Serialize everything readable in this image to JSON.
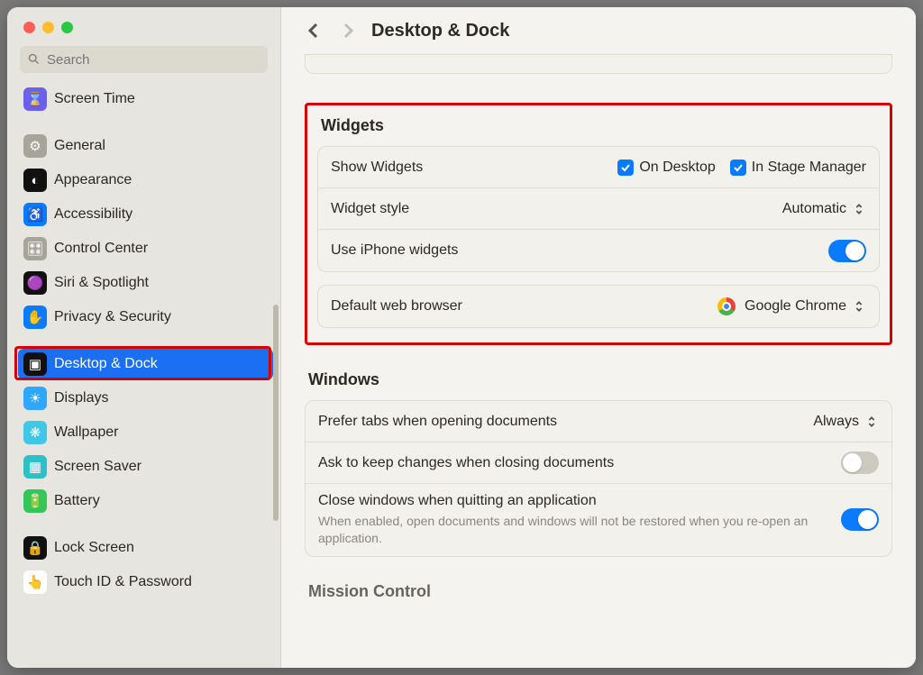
{
  "header": {
    "title": "Desktop & Dock"
  },
  "search": {
    "placeholder": "Search"
  },
  "sidebar": {
    "items": [
      {
        "label": "Screen Time",
        "icon": "hourglass-icon",
        "bg": "#6b5ff0"
      },
      {
        "sep": true
      },
      {
        "label": "General",
        "icon": "gear-icon",
        "bg": "#a7a49c"
      },
      {
        "label": "Appearance",
        "icon": "appearance-icon",
        "bg": "#111"
      },
      {
        "label": "Accessibility",
        "icon": "accessibility-icon",
        "bg": "#0a7aff"
      },
      {
        "label": "Control Center",
        "icon": "switches-icon",
        "bg": "#a7a49c"
      },
      {
        "label": "Siri & Spotlight",
        "icon": "siri-icon",
        "bg": "#111"
      },
      {
        "label": "Privacy & Security",
        "icon": "hand-icon",
        "bg": "#0a7aff"
      },
      {
        "sep": true
      },
      {
        "label": "Desktop & Dock",
        "icon": "dock-icon",
        "bg": "#111",
        "selected": true
      },
      {
        "label": "Displays",
        "icon": "brightness-icon",
        "bg": "#2fa7ff"
      },
      {
        "label": "Wallpaper",
        "icon": "flower-icon",
        "bg": "#41c6e8"
      },
      {
        "label": "Screen Saver",
        "icon": "screensaver-icon",
        "bg": "#2fbfc9"
      },
      {
        "label": "Battery",
        "icon": "battery-icon",
        "bg": "#33c759"
      },
      {
        "sep": true
      },
      {
        "label": "Lock Screen",
        "icon": "lock-icon",
        "bg": "#111"
      },
      {
        "label": "Touch ID & Password",
        "icon": "fingerprint-icon",
        "bg": "#fff"
      }
    ]
  },
  "widgets": {
    "title": "Widgets",
    "show_label": "Show Widgets",
    "on_desktop": "On Desktop",
    "in_stage": "In Stage Manager",
    "style_label": "Widget style",
    "style_value": "Automatic",
    "iphone_label": "Use iPhone widgets",
    "browser_label": "Default web browser",
    "browser_value": "Google Chrome"
  },
  "windows": {
    "title": "Windows",
    "prefer_tabs_label": "Prefer tabs when opening documents",
    "prefer_tabs_value": "Always",
    "ask_label": "Ask to keep changes when closing documents",
    "close_label": "Close windows when quitting an application",
    "close_detail": "When enabled, open documents and windows will not be restored when you re-open an application."
  },
  "next_section": {
    "title": "Mission Control"
  },
  "icons": {
    "hourglass-icon": "⌛",
    "gear-icon": "⚙",
    "appearance-icon": "◐",
    "accessibility-icon": "♿",
    "switches-icon": "🎛",
    "siri-icon": "🟣",
    "hand-icon": "✋",
    "dock-icon": "▣",
    "brightness-icon": "☀",
    "flower-icon": "❋",
    "screensaver-icon": "▦",
    "battery-icon": "🔋",
    "lock-icon": "🔒",
    "fingerprint-icon": "👆"
  }
}
